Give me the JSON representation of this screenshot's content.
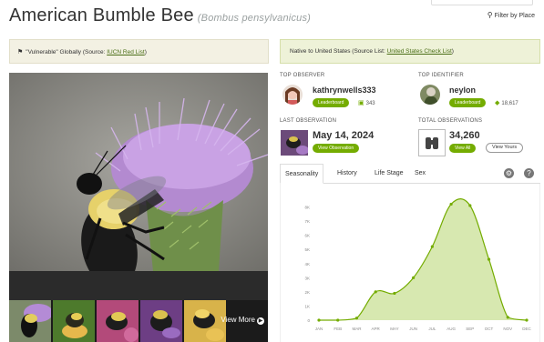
{
  "header": {
    "title": "American Bumble Bee",
    "scientific_name": "(Bombus pensylvanicus)",
    "filter_label": "Filter by Place",
    "filter_icon": "map-pin-icon"
  },
  "status": {
    "conservation_prefix": "\"Vulnerable\" Globally (Source: ",
    "conservation_source": "IUCN Red List",
    "conservation_suffix": ")",
    "native_prefix": "Native to United States (Source List: ",
    "native_source": "United States Check List",
    "native_suffix": ")"
  },
  "photos": {
    "view_more_label": "View More",
    "thumbnail_count": 5
  },
  "stats": {
    "top_observer": {
      "label": "Top Observer",
      "name": "kathrynwells333",
      "button": "Leaderboard",
      "count": "343"
    },
    "top_identifier": {
      "label": "Top Identifier",
      "name": "neylon",
      "button": "Leaderboard",
      "count": "18,617"
    },
    "last_observation": {
      "label": "Last Observation",
      "date": "May 14, 2024",
      "button": "View Observation"
    },
    "total_observations": {
      "label": "Total Observations",
      "value": "34,260",
      "button_all": "View All",
      "button_yours": "View Yours"
    }
  },
  "tabs": [
    {
      "label": "Seasonality",
      "active": true
    },
    {
      "label": "History",
      "active": false
    },
    {
      "label": "Life Stage",
      "active": false
    },
    {
      "label": "Sex",
      "active": false
    }
  ],
  "colors": {
    "accent": "#74ac00",
    "chart_fill": "#d7e8b0",
    "chart_line": "#74ac00"
  },
  "chart_data": {
    "type": "area",
    "categories": [
      "JAN",
      "FEB",
      "MAR",
      "APR",
      "MAY",
      "JUN",
      "JUL",
      "AUG",
      "SEP",
      "OCT",
      "NOV",
      "DEC"
    ],
    "values": [
      0,
      0,
      150,
      2000,
      1900,
      3000,
      5200,
      8200,
      8100,
      4300,
      200,
      0
    ],
    "y_ticks": [
      "0",
      "1K",
      "2K",
      "3K",
      "4K",
      "5K",
      "6K",
      "7K",
      "8K"
    ],
    "ylim": [
      0,
      9000
    ],
    "grid": false,
    "legend": "none"
  }
}
